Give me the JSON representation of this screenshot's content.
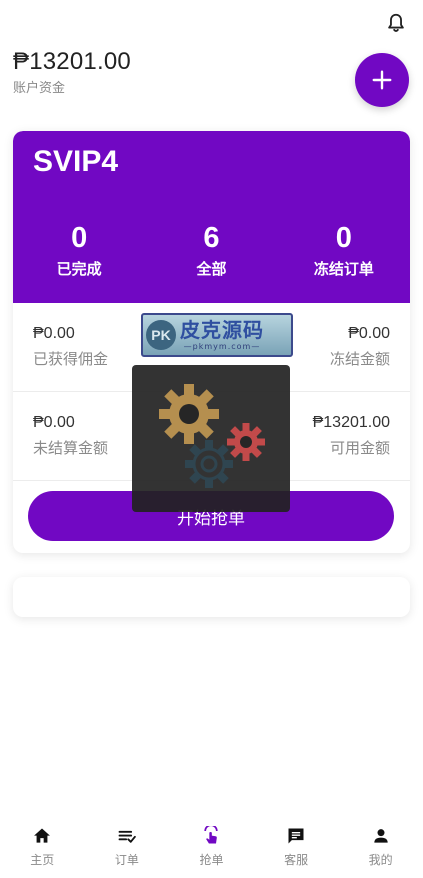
{
  "header": {
    "balance": "₱13201.00",
    "balance_label": "账户资金"
  },
  "vip": {
    "level": "SVIP4",
    "stats": [
      {
        "value": "0",
        "label": "已完成"
      },
      {
        "value": "6",
        "label": "全部"
      },
      {
        "value": "0",
        "label": "冻结订单"
      }
    ]
  },
  "funds": {
    "earned_commission": {
      "amount": "₱0.00",
      "label": "已获得佣金"
    },
    "frozen_amount": {
      "amount": "₱0.00",
      "label": "冻结金额"
    },
    "unsettled_amount": {
      "amount": "₱0.00",
      "label": "未结算金额"
    },
    "available_amount": {
      "amount": "₱13201.00",
      "label": "可用金额"
    }
  },
  "start_button": "开始抢单",
  "watermark": {
    "badge": "PK",
    "text": "皮克源码",
    "url": "—pkmym.com—"
  },
  "tabbar": [
    {
      "label": "主页",
      "icon": "home-icon"
    },
    {
      "label": "订单",
      "icon": "order-list-icon"
    },
    {
      "label": "抢单",
      "icon": "grab-order-icon",
      "active": true
    },
    {
      "label": "客服",
      "icon": "chat-icon"
    },
    {
      "label": "我的",
      "icon": "user-icon"
    }
  ],
  "colors": {
    "accent": "#7108c3",
    "gear_gold": "#b58f4f",
    "gear_red": "#c24a4a",
    "gear_dark": "#2f4550"
  }
}
